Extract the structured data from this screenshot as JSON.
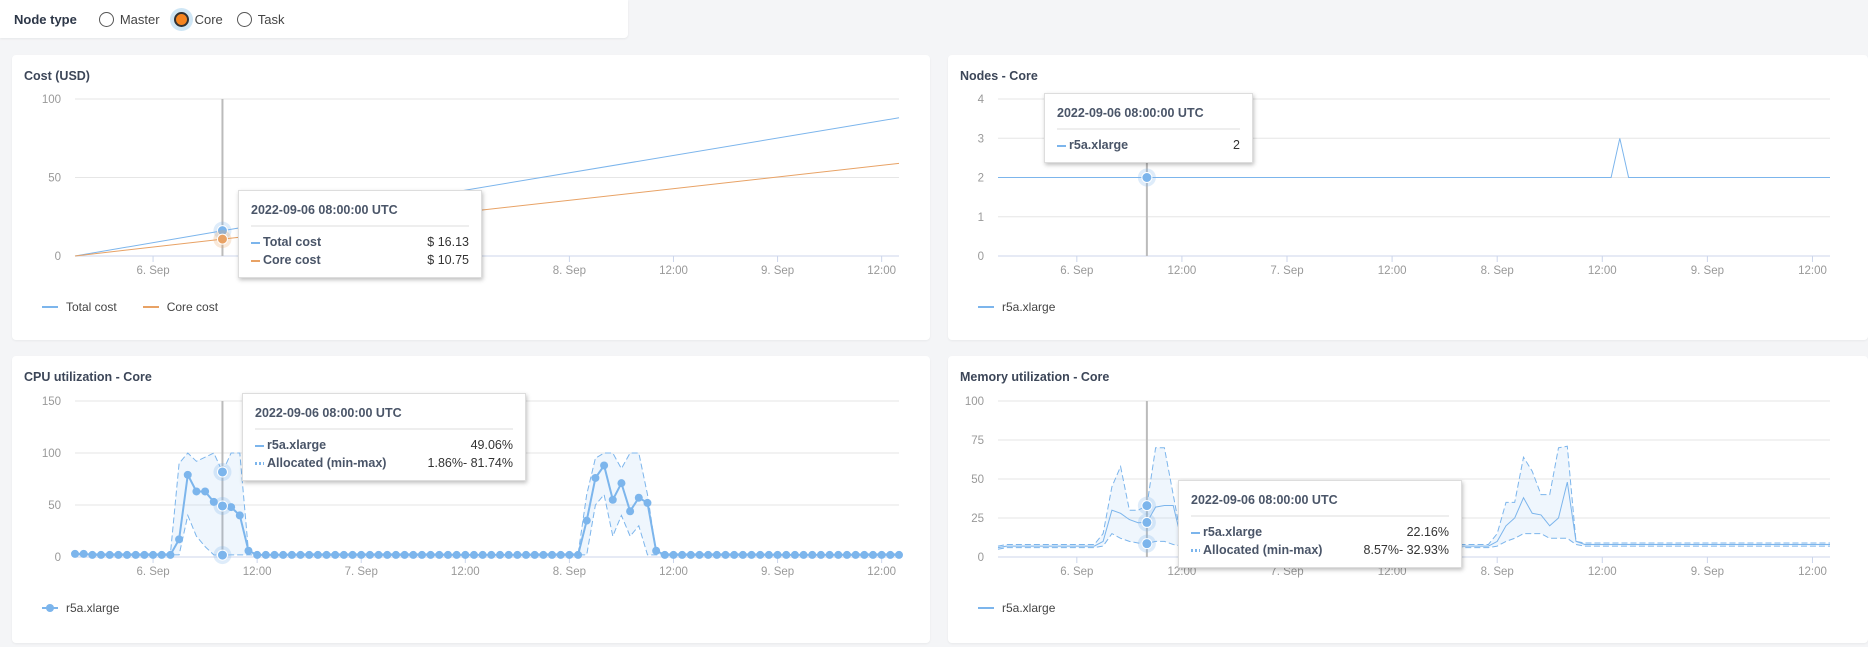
{
  "filter": {
    "label": "Node type",
    "options": [
      {
        "label": "Master",
        "selected": false
      },
      {
        "label": "Core",
        "selected": true
      },
      {
        "label": "Task",
        "selected": false
      }
    ]
  },
  "colors": {
    "blue": "#7cb5ec",
    "orange": "#e8a265",
    "selected_radio": "#f5841f"
  },
  "x_axis": {
    "start": "2022-09-05T15:00:00Z",
    "end": "2022-09-09T14:00:00Z",
    "tick_labels": [
      "6. Sep",
      "12:00",
      "7. Sep",
      "12:00",
      "8. Sep",
      "12:00",
      "9. Sep",
      "12:00"
    ]
  },
  "chart_data": [
    {
      "id": "cost",
      "type": "line",
      "title": "Cost (USD)",
      "ylim": [
        0,
        100
      ],
      "yticks": [
        "0",
        "50",
        "100"
      ],
      "legend": "bottom-left",
      "series": [
        {
          "name": "Total cost",
          "color": "#7cb5ec",
          "points": [
            [
              "2022-09-05T15:00:00Z",
              0
            ],
            [
              "2022-09-06T08:00:00Z",
              16.13
            ],
            [
              "2022-09-09T14:00:00Z",
              88
            ]
          ]
        },
        {
          "name": "Core cost",
          "color": "#e8a265",
          "points": [
            [
              "2022-09-05T15:00:00Z",
              0
            ],
            [
              "2022-09-06T08:00:00Z",
              10.75
            ],
            [
              "2022-09-09T14:00:00Z",
              59
            ]
          ]
        }
      ],
      "tooltip": {
        "time": "2022-09-06 08:00:00 UTC",
        "rows": [
          {
            "name": "Total cost",
            "value": "$ 16.13"
          },
          {
            "name": "Core cost",
            "value": "$ 10.75"
          }
        ]
      }
    },
    {
      "id": "nodes",
      "type": "line",
      "title": "Nodes - Core",
      "ylim": [
        0,
        4
      ],
      "yticks": [
        "0",
        "1",
        "2",
        "3",
        "4"
      ],
      "legend": "bottom-left",
      "series": [
        {
          "name": "r5a.xlarge",
          "color": "#7cb5ec",
          "points": [
            [
              "2022-09-05T15:00:00Z",
              2
            ],
            [
              "2022-09-06T08:00:00Z",
              2
            ],
            [
              "2022-09-08T13:00:00Z",
              2
            ],
            [
              "2022-09-08T14:00:00Z",
              3
            ],
            [
              "2022-09-08T15:00:00Z",
              2
            ],
            [
              "2022-09-09T14:00:00Z",
              2
            ]
          ]
        }
      ],
      "tooltip": {
        "time": "2022-09-06 08:00:00 UTC",
        "rows": [
          {
            "name": "r5a.xlarge",
            "value": "2"
          }
        ]
      }
    },
    {
      "id": "cpu",
      "type": "line",
      "title": "CPU utilization - Core",
      "ylim": [
        0,
        150
      ],
      "yticks": [
        "0",
        "50",
        "100",
        "150"
      ],
      "legend": "bottom-left",
      "markers": true,
      "interval_hours": 1,
      "series": [
        {
          "name": "r5a.xlarge",
          "color": "#7cb5ec",
          "values": [
            3,
            3,
            2,
            2,
            2,
            2,
            2,
            2,
            2,
            2,
            2,
            2,
            17,
            79,
            63,
            63,
            53,
            49.06,
            48,
            40,
            6,
            2,
            2,
            2,
            2,
            2,
            2,
            2,
            2,
            2,
            2,
            2,
            2,
            2,
            2,
            2,
            2,
            2,
            2,
            2,
            2,
            2,
            2,
            2,
            2,
            2,
            2,
            2,
            2,
            2,
            2,
            2,
            2,
            2,
            2,
            2,
            2,
            2,
            2,
            35,
            76,
            88,
            55,
            71,
            44,
            57,
            52,
            6,
            2,
            2,
            2,
            2,
            2,
            2,
            2,
            2,
            2,
            2,
            2,
            2,
            2,
            2,
            2,
            2,
            2,
            2,
            2,
            2,
            2,
            2,
            2,
            2,
            2,
            2,
            2,
            2
          ],
          "min": [
            2,
            2,
            2,
            2,
            2,
            2,
            2,
            2,
            2,
            2,
            2,
            2,
            2,
            40,
            20,
            10,
            2,
            1.86,
            2,
            2,
            2,
            2,
            2,
            2,
            2,
            2,
            2,
            2,
            2,
            2,
            2,
            2,
            2,
            2,
            2,
            2,
            2,
            2,
            2,
            2,
            2,
            2,
            2,
            2,
            2,
            2,
            2,
            2,
            2,
            2,
            2,
            2,
            2,
            2,
            2,
            2,
            2,
            2,
            2,
            2,
            50,
            60,
            20,
            40,
            20,
            30,
            2,
            2,
            2,
            2,
            2,
            2,
            2,
            2,
            2,
            2,
            2,
            2,
            2,
            2,
            2,
            2,
            2,
            2,
            2,
            2,
            2,
            2,
            2,
            2,
            2,
            2,
            2,
            2,
            2,
            2
          ],
          "max": [
            3,
            3,
            3,
            3,
            3,
            3,
            3,
            3,
            3,
            3,
            3,
            3,
            90,
            100,
            92,
            96,
            100,
            81.74,
            100,
            100,
            5,
            3,
            3,
            3,
            3,
            3,
            3,
            3,
            3,
            3,
            3,
            3,
            3,
            3,
            3,
            3,
            3,
            3,
            3,
            3,
            3,
            3,
            3,
            3,
            3,
            3,
            3,
            3,
            3,
            3,
            3,
            3,
            3,
            3,
            3,
            3,
            3,
            3,
            3,
            60,
            95,
            100,
            100,
            85,
            100,
            100,
            60,
            5,
            3,
            3,
            3,
            3,
            3,
            3,
            3,
            3,
            3,
            3,
            3,
            3,
            3,
            3,
            3,
            3,
            3,
            3,
            3,
            3,
            3,
            3,
            3,
            3,
            3,
            3,
            3,
            3
          ]
        }
      ],
      "tooltip": {
        "time": "2022-09-06 08:00:00 UTC",
        "rows": [
          {
            "name": "r5a.xlarge",
            "value": "49.06%"
          },
          {
            "name": "Allocated (min-max)",
            "value": "1.86%- 81.74%"
          }
        ]
      }
    },
    {
      "id": "mem",
      "type": "line",
      "title": "Memory utilization - Core",
      "ylim": [
        0,
        100
      ],
      "yticks": [
        "0",
        "25",
        "50",
        "75",
        "100"
      ],
      "legend": "bottom-left",
      "markers": false,
      "interval_hours": 1,
      "series": [
        {
          "name": "r5a.xlarge",
          "color": "#7cb5ec",
          "values": [
            6,
            7,
            7,
            7,
            7,
            7,
            7,
            7,
            7,
            7,
            7,
            7,
            10,
            30,
            28,
            24,
            22,
            22.16,
            32,
            33,
            33,
            10,
            7,
            7,
            7,
            7,
            7,
            7,
            7,
            7,
            7,
            7,
            7,
            7,
            7,
            7,
            7,
            7,
            7,
            7,
            7,
            7,
            7,
            7,
            7,
            7,
            7,
            7,
            7,
            7,
            7,
            7,
            7,
            7,
            7,
            7,
            7,
            10,
            20,
            25,
            38,
            28,
            27,
            20,
            25,
            48,
            10,
            8,
            8,
            8,
            8,
            8,
            8,
            8,
            8,
            8,
            8,
            8,
            8,
            8,
            8,
            8,
            8,
            8,
            8,
            8,
            8,
            8,
            8,
            8,
            8,
            8,
            8,
            8,
            8,
            8
          ],
          "min": [
            5,
            6,
            6,
            6,
            6,
            6,
            6,
            6,
            6,
            6,
            6,
            6,
            7,
            15,
            12,
            10,
            9,
            8.57,
            10,
            10,
            8,
            7,
            6,
            6,
            6,
            6,
            6,
            6,
            6,
            6,
            6,
            6,
            6,
            6,
            6,
            6,
            6,
            6,
            6,
            6,
            6,
            6,
            6,
            6,
            6,
            6,
            6,
            6,
            6,
            6,
            6,
            6,
            6,
            6,
            6,
            6,
            6,
            7,
            10,
            12,
            15,
            15,
            15,
            12,
            12,
            12,
            8,
            7,
            7,
            7,
            7,
            7,
            7,
            7,
            7,
            7,
            7,
            7,
            7,
            7,
            7,
            7,
            7,
            7,
            7,
            7,
            7,
            7,
            7,
            7,
            7,
            7,
            7,
            7,
            7,
            7
          ],
          "max": [
            7,
            8,
            8,
            8,
            8,
            8,
            8,
            8,
            8,
            8,
            8,
            8,
            15,
            45,
            58,
            30,
            30,
            32.93,
            70,
            70,
            40,
            10,
            8,
            8,
            8,
            8,
            8,
            8,
            8,
            8,
            8,
            8,
            8,
            8,
            8,
            8,
            8,
            8,
            8,
            8,
            8,
            8,
            8,
            8,
            8,
            8,
            8,
            8,
            8,
            8,
            8,
            8,
            8,
            8,
            8,
            8,
            8,
            15,
            35,
            35,
            64,
            55,
            40,
            40,
            70,
            71,
            10,
            9,
            9,
            9,
            9,
            9,
            9,
            9,
            9,
            9,
            9,
            9,
            9,
            9,
            9,
            9,
            9,
            9,
            9,
            9,
            9,
            9,
            9,
            9,
            9,
            9,
            9,
            9,
            9,
            9
          ]
        }
      ],
      "tooltip": {
        "time": "2022-09-06 08:00:00 UTC",
        "rows": [
          {
            "name": "r5a.xlarge",
            "value": "22.16%"
          },
          {
            "name": "Allocated (min-max)",
            "value": "8.57%- 32.93%"
          }
        ]
      }
    }
  ]
}
